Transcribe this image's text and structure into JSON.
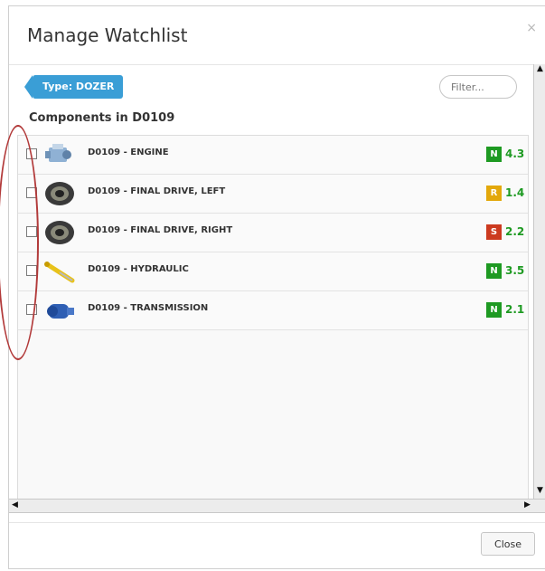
{
  "modal": {
    "title": "Manage Watchlist",
    "close_symbol": "×"
  },
  "type_tag": "Type: DOZER",
  "filter_placeholder": "Filter...",
  "section_title": "Components in D0109",
  "components": [
    {
      "label": "D0109 - ENGINE",
      "badge": "N",
      "badge_color": "#1e9a22",
      "score": "4.3",
      "score_color": "#1e9a22",
      "icon": "engine-icon"
    },
    {
      "label": "D0109 - FINAL DRIVE, LEFT",
      "badge": "R",
      "badge_color": "#e3a80b",
      "score": "1.4",
      "score_color": "#1e9a22",
      "icon": "final-drive-icon"
    },
    {
      "label": "D0109 - FINAL DRIVE, RIGHT",
      "badge": "S",
      "badge_color": "#cc3a1f",
      "score": "2.2",
      "score_color": "#1e9a22",
      "icon": "final-drive-icon"
    },
    {
      "label": "D0109 - HYDRAULIC",
      "badge": "N",
      "badge_color": "#1e9a22",
      "score": "3.5",
      "score_color": "#1e9a22",
      "icon": "hydraulic-cylinder-icon"
    },
    {
      "label": "D0109 - TRANSMISSION",
      "badge": "N",
      "badge_color": "#1e9a22",
      "score": "2.1",
      "score_color": "#1e9a22",
      "icon": "transmission-icon"
    }
  ],
  "footer": {
    "close_label": "Close"
  }
}
